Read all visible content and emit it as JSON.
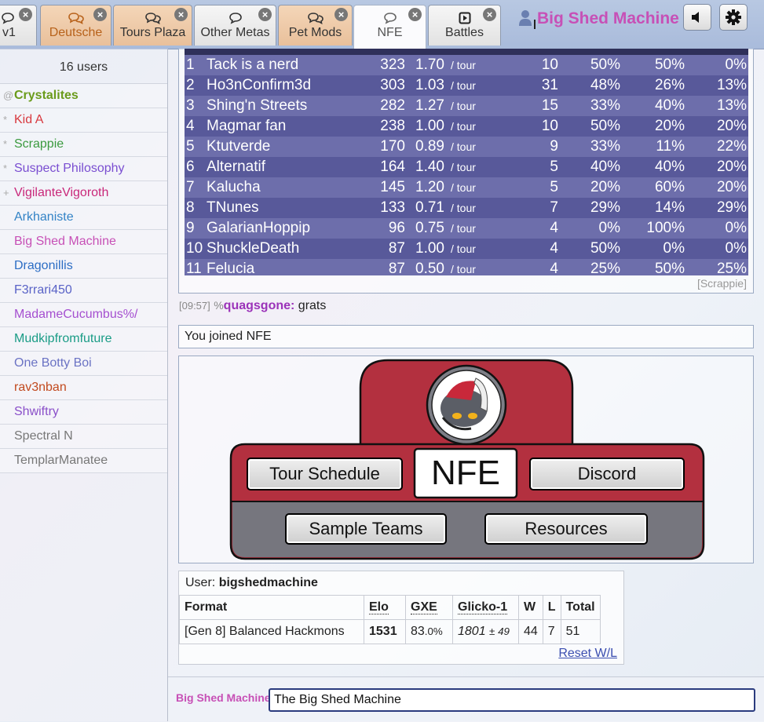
{
  "tabs": [
    {
      "label": "v1",
      "icon": "chat-icon"
    },
    {
      "label": "Deutsche",
      "icon": "chat-multiple-icon"
    },
    {
      "label": "Tours Plaza",
      "icon": "chat-multiple-icon"
    },
    {
      "label": "Other Metas",
      "icon": "chat-icon"
    },
    {
      "label": "Pet Mods",
      "icon": "chat-multiple-icon"
    },
    {
      "label": "NFE",
      "icon": "chat-icon"
    },
    {
      "label": "Battles",
      "icon": "play-icon"
    }
  ],
  "header": {
    "username": "Big Shed Machine",
    "sound_icon": "volume-icon",
    "settings_icon": "gear-icon"
  },
  "userlist": {
    "count": "16 users",
    "users": [
      {
        "rank": "@",
        "name": "Crystalites",
        "color": "#6a9b1b",
        "bold": true
      },
      {
        "rank": "*",
        "name": "Kid A",
        "color": "#d8393f"
      },
      {
        "rank": "*",
        "name": "Scrappie",
        "color": "#3b9a3f"
      },
      {
        "rank": "*",
        "name": "Suspect Philosophy",
        "color": "#7a4ed1"
      },
      {
        "rank": "+",
        "name": "VigilanteVigoroth",
        "color": "#c9287a"
      },
      {
        "rank": "",
        "name": "Arkhaniste",
        "color": "#3383c6"
      },
      {
        "rank": "",
        "name": "Big Shed Machine",
        "color": "#c750b6"
      },
      {
        "rank": "",
        "name": "Dragonillis",
        "color": "#2c6dc4"
      },
      {
        "rank": "",
        "name": "F3rrari450",
        "color": "#5a63c7"
      },
      {
        "rank": "",
        "name": "MadameCucumbus%/",
        "color": "#a54fd0"
      },
      {
        "rank": "",
        "name": "Mudkipfromfuture",
        "color": "#1a9c86"
      },
      {
        "rank": "",
        "name": "One Botty Boi",
        "color": "#6b73c4"
      },
      {
        "rank": "",
        "name": "rav3nban",
        "color": "#c24a1f"
      },
      {
        "rank": "",
        "name": "Shwiftry",
        "color": "#8a4fc9"
      },
      {
        "rank": "",
        "name": "Spectral N",
        "color": "#777777"
      },
      {
        "rank": "",
        "name": "TemplarManatee",
        "color": "#777777"
      }
    ]
  },
  "leaderboard": {
    "per": "/ tour",
    "source": "[Scrappie]",
    "rows": [
      [
        "1",
        "Tack is a nerd",
        "323",
        "1.70",
        "10",
        "50%",
        "50%",
        "0%"
      ],
      [
        "2",
        "Ho3nConfirm3d",
        "303",
        "1.03",
        "31",
        "48%",
        "26%",
        "13%"
      ],
      [
        "3",
        "Shing'n Streets",
        "282",
        "1.27",
        "15",
        "33%",
        "40%",
        "13%"
      ],
      [
        "4",
        "Magmar fan",
        "238",
        "1.00",
        "10",
        "50%",
        "20%",
        "20%"
      ],
      [
        "5",
        "Ktutverde",
        "170",
        "0.89",
        "9",
        "33%",
        "11%",
        "22%"
      ],
      [
        "6",
        "Alternatif",
        "164",
        "1.40",
        "5",
        "40%",
        "40%",
        "20%"
      ],
      [
        "7",
        "Kalucha",
        "145",
        "1.20",
        "5",
        "20%",
        "60%",
        "20%"
      ],
      [
        "8",
        "TNunes",
        "133",
        "0.71",
        "7",
        "29%",
        "14%",
        "29%"
      ],
      [
        "9",
        "GalarianHoppip",
        "96",
        "0.75",
        "4",
        "0%",
        "100%",
        "0%"
      ],
      [
        "10",
        "ShuckleDeath",
        "87",
        "1.00",
        "4",
        "50%",
        "0%",
        "0%"
      ],
      [
        "11",
        "Felucia",
        "87",
        "0.50",
        "4",
        "25%",
        "50%",
        "25%"
      ]
    ]
  },
  "chat": {
    "timestamp": "[09:57]",
    "rank": "%",
    "name": "quagsgone:",
    "message": "grats",
    "joined": "You joined NFE"
  },
  "banner": {
    "title": "NFE",
    "buttons": {
      "tour_schedule": "Tour Schedule",
      "discord": "Discord",
      "sample_teams": "Sample Teams",
      "resources": "Resources"
    },
    "logo_icon": "pokemon-pawniard-icon"
  },
  "stats": {
    "user_label": "User:",
    "user": "bigshedmachine",
    "headers": [
      "Format",
      "Elo",
      "GXE",
      "Glicko-1",
      "W",
      "L",
      "Total"
    ],
    "row": {
      "format": "[Gen 8] Balanced Hackmons",
      "elo": "1531",
      "gxe": "83",
      "gxe_dec": ".0%",
      "glicko": "1801",
      "glicko_dev": "± 49",
      "w": "44",
      "l": "7",
      "total": "51"
    },
    "reset": "Reset W/L"
  },
  "input": {
    "name": "Big Shed Machine",
    "value": "The Big Shed Machine"
  }
}
